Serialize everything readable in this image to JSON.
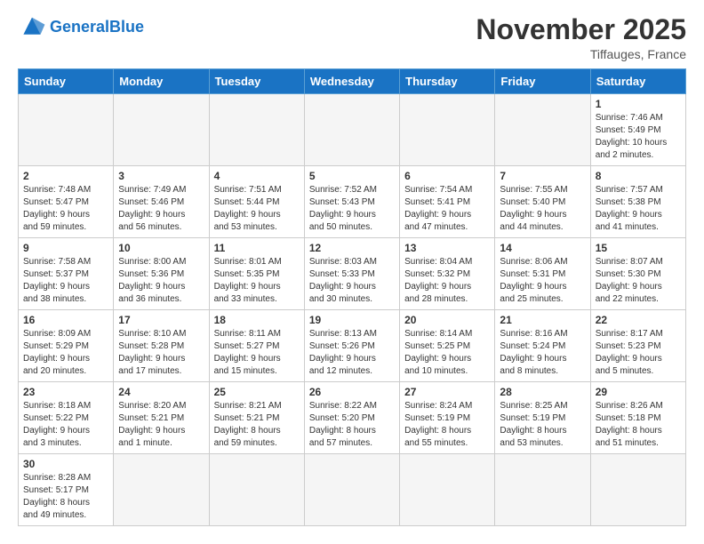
{
  "header": {
    "logo_general": "General",
    "logo_blue": "Blue",
    "month_title": "November 2025",
    "location": "Tiffauges, France"
  },
  "weekdays": [
    "Sunday",
    "Monday",
    "Tuesday",
    "Wednesday",
    "Thursday",
    "Friday",
    "Saturday"
  ],
  "weeks": [
    [
      {
        "day": "",
        "info": ""
      },
      {
        "day": "",
        "info": ""
      },
      {
        "day": "",
        "info": ""
      },
      {
        "day": "",
        "info": ""
      },
      {
        "day": "",
        "info": ""
      },
      {
        "day": "",
        "info": ""
      },
      {
        "day": "1",
        "info": "Sunrise: 7:46 AM\nSunset: 5:49 PM\nDaylight: 10 hours\nand 2 minutes."
      }
    ],
    [
      {
        "day": "2",
        "info": "Sunrise: 7:48 AM\nSunset: 5:47 PM\nDaylight: 9 hours\nand 59 minutes."
      },
      {
        "day": "3",
        "info": "Sunrise: 7:49 AM\nSunset: 5:46 PM\nDaylight: 9 hours\nand 56 minutes."
      },
      {
        "day": "4",
        "info": "Sunrise: 7:51 AM\nSunset: 5:44 PM\nDaylight: 9 hours\nand 53 minutes."
      },
      {
        "day": "5",
        "info": "Sunrise: 7:52 AM\nSunset: 5:43 PM\nDaylight: 9 hours\nand 50 minutes."
      },
      {
        "day": "6",
        "info": "Sunrise: 7:54 AM\nSunset: 5:41 PM\nDaylight: 9 hours\nand 47 minutes."
      },
      {
        "day": "7",
        "info": "Sunrise: 7:55 AM\nSunset: 5:40 PM\nDaylight: 9 hours\nand 44 minutes."
      },
      {
        "day": "8",
        "info": "Sunrise: 7:57 AM\nSunset: 5:38 PM\nDaylight: 9 hours\nand 41 minutes."
      }
    ],
    [
      {
        "day": "9",
        "info": "Sunrise: 7:58 AM\nSunset: 5:37 PM\nDaylight: 9 hours\nand 38 minutes."
      },
      {
        "day": "10",
        "info": "Sunrise: 8:00 AM\nSunset: 5:36 PM\nDaylight: 9 hours\nand 36 minutes."
      },
      {
        "day": "11",
        "info": "Sunrise: 8:01 AM\nSunset: 5:35 PM\nDaylight: 9 hours\nand 33 minutes."
      },
      {
        "day": "12",
        "info": "Sunrise: 8:03 AM\nSunset: 5:33 PM\nDaylight: 9 hours\nand 30 minutes."
      },
      {
        "day": "13",
        "info": "Sunrise: 8:04 AM\nSunset: 5:32 PM\nDaylight: 9 hours\nand 28 minutes."
      },
      {
        "day": "14",
        "info": "Sunrise: 8:06 AM\nSunset: 5:31 PM\nDaylight: 9 hours\nand 25 minutes."
      },
      {
        "day": "15",
        "info": "Sunrise: 8:07 AM\nSunset: 5:30 PM\nDaylight: 9 hours\nand 22 minutes."
      }
    ],
    [
      {
        "day": "16",
        "info": "Sunrise: 8:09 AM\nSunset: 5:29 PM\nDaylight: 9 hours\nand 20 minutes."
      },
      {
        "day": "17",
        "info": "Sunrise: 8:10 AM\nSunset: 5:28 PM\nDaylight: 9 hours\nand 17 minutes."
      },
      {
        "day": "18",
        "info": "Sunrise: 8:11 AM\nSunset: 5:27 PM\nDaylight: 9 hours\nand 15 minutes."
      },
      {
        "day": "19",
        "info": "Sunrise: 8:13 AM\nSunset: 5:26 PM\nDaylight: 9 hours\nand 12 minutes."
      },
      {
        "day": "20",
        "info": "Sunrise: 8:14 AM\nSunset: 5:25 PM\nDaylight: 9 hours\nand 10 minutes."
      },
      {
        "day": "21",
        "info": "Sunrise: 8:16 AM\nSunset: 5:24 PM\nDaylight: 9 hours\nand 8 minutes."
      },
      {
        "day": "22",
        "info": "Sunrise: 8:17 AM\nSunset: 5:23 PM\nDaylight: 9 hours\nand 5 minutes."
      }
    ],
    [
      {
        "day": "23",
        "info": "Sunrise: 8:18 AM\nSunset: 5:22 PM\nDaylight: 9 hours\nand 3 minutes."
      },
      {
        "day": "24",
        "info": "Sunrise: 8:20 AM\nSunset: 5:21 PM\nDaylight: 9 hours\nand 1 minute."
      },
      {
        "day": "25",
        "info": "Sunrise: 8:21 AM\nSunset: 5:21 PM\nDaylight: 8 hours\nand 59 minutes."
      },
      {
        "day": "26",
        "info": "Sunrise: 8:22 AM\nSunset: 5:20 PM\nDaylight: 8 hours\nand 57 minutes."
      },
      {
        "day": "27",
        "info": "Sunrise: 8:24 AM\nSunset: 5:19 PM\nDaylight: 8 hours\nand 55 minutes."
      },
      {
        "day": "28",
        "info": "Sunrise: 8:25 AM\nSunset: 5:19 PM\nDaylight: 8 hours\nand 53 minutes."
      },
      {
        "day": "29",
        "info": "Sunrise: 8:26 AM\nSunset: 5:18 PM\nDaylight: 8 hours\nand 51 minutes."
      }
    ],
    [
      {
        "day": "30",
        "info": "Sunrise: 8:28 AM\nSunset: 5:17 PM\nDaylight: 8 hours\nand 49 minutes."
      },
      {
        "day": "",
        "info": ""
      },
      {
        "day": "",
        "info": ""
      },
      {
        "day": "",
        "info": ""
      },
      {
        "day": "",
        "info": ""
      },
      {
        "day": "",
        "info": ""
      },
      {
        "day": "",
        "info": ""
      }
    ]
  ]
}
